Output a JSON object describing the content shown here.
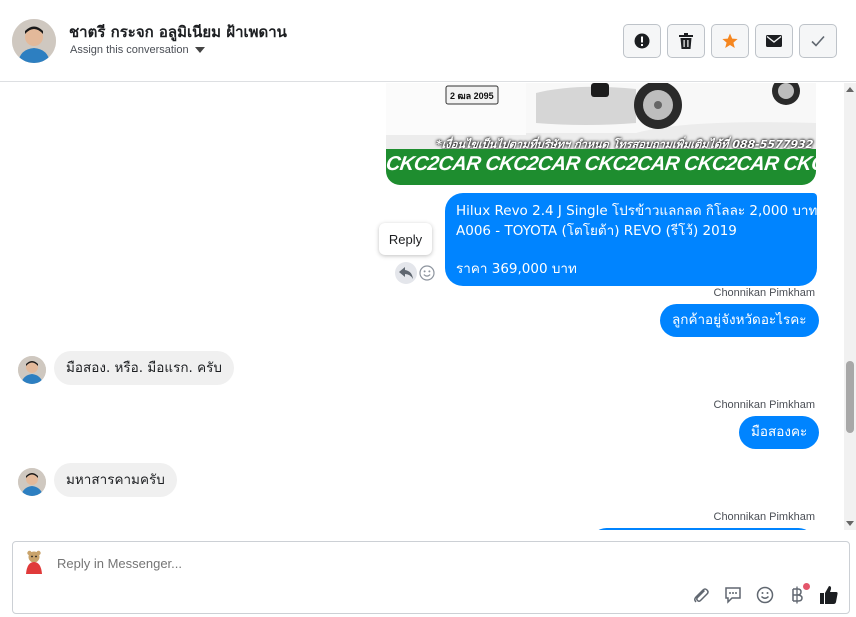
{
  "header": {
    "contact_name": "ชาตรี กระจก อลูมิเนียม ฝ้าเพดาน",
    "assign_label": "Assign this conversation",
    "actions": [
      {
        "name": "spam-button",
        "icon": "exclamation-icon"
      },
      {
        "name": "delete-button",
        "icon": "trash-icon"
      },
      {
        "name": "star-button",
        "icon": "star-icon"
      },
      {
        "name": "mark-unread-button",
        "icon": "envelope-icon"
      },
      {
        "name": "mark-done-button",
        "icon": "check-icon"
      }
    ]
  },
  "image": {
    "caption": "*เงื่อนไขเป็นไปตามที่บริษัทฯ กำหนด โทรสอบถามเพิ่มเติมได้ที่ 088-5577932",
    "banner": "CKC2CAR CKC2CAR CKC2CAR CKC2CAR CKC2CAR CKC2",
    "plate": "2 ฒล 2095"
  },
  "reply_tooltip": "Reply",
  "messages": [
    {
      "direction": "out",
      "line1": "Hilux Revo 2.4 J Single โปรข้าวแลกลด กิโลละ 2,000 บาท",
      "line2": "A006 - TOYOTA (โตโยต้า) REVO (รีโว้) 2019",
      "line3": "ราคา 369,000 บาท"
    },
    {
      "direction": "out",
      "sender": "Chonnikan Pimkham",
      "text": "ลูกค้าอยู่จังหวัดอะไรคะ"
    },
    {
      "direction": "in",
      "text": "มือสอง.  หรือ. มือแรก.  ครับ"
    },
    {
      "direction": "out",
      "sender": "Chonnikan Pimkham",
      "text": "มือสองคะ"
    },
    {
      "direction": "in",
      "text": "มหาสารคามครับ"
    },
    {
      "direction": "out",
      "sender": "Chonnikan Pimkham",
      "text": ""
    }
  ],
  "composer": {
    "placeholder": "Reply in Messenger...",
    "tools": [
      "paperclip-icon",
      "saved-reply-icon",
      "emoji-icon",
      "baht-icon",
      "thumbs-up-icon"
    ]
  },
  "colors": {
    "outgoing_bubble": "#0084ff",
    "incoming_bubble": "#f0f0f0",
    "star": "#f5861f",
    "banner_green": "#1e8d2f"
  }
}
